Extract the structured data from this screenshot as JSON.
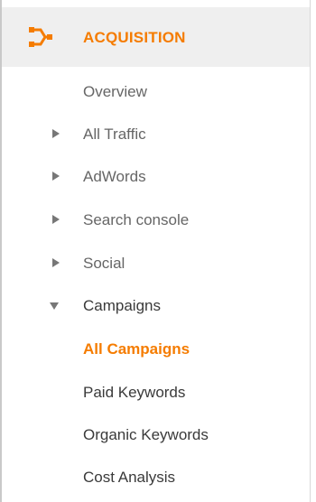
{
  "colors": {
    "accent": "#f57c00",
    "text_muted": "#666666",
    "text_dark": "#3a3a3a",
    "header_bg": "#efefef",
    "arrow": "#777777"
  },
  "header": {
    "icon": "acquisition-fork-icon",
    "title": "ACQUISITION"
  },
  "nav": {
    "overview": {
      "label": "Overview"
    },
    "all_traffic": {
      "label": "All Traffic",
      "expanded": false
    },
    "adwords": {
      "label": "AdWords",
      "expanded": false
    },
    "search_console": {
      "label": "Search console",
      "expanded": false
    },
    "social": {
      "label": "Social",
      "expanded": false
    },
    "campaigns": {
      "label": "Campaigns",
      "expanded": true,
      "children": [
        {
          "label": "All Campaigns",
          "active": true
        },
        {
          "label": "Paid Keywords",
          "active": false
        },
        {
          "label": "Organic Keywords",
          "active": false
        },
        {
          "label": "Cost Analysis",
          "active": false
        }
      ]
    }
  }
}
